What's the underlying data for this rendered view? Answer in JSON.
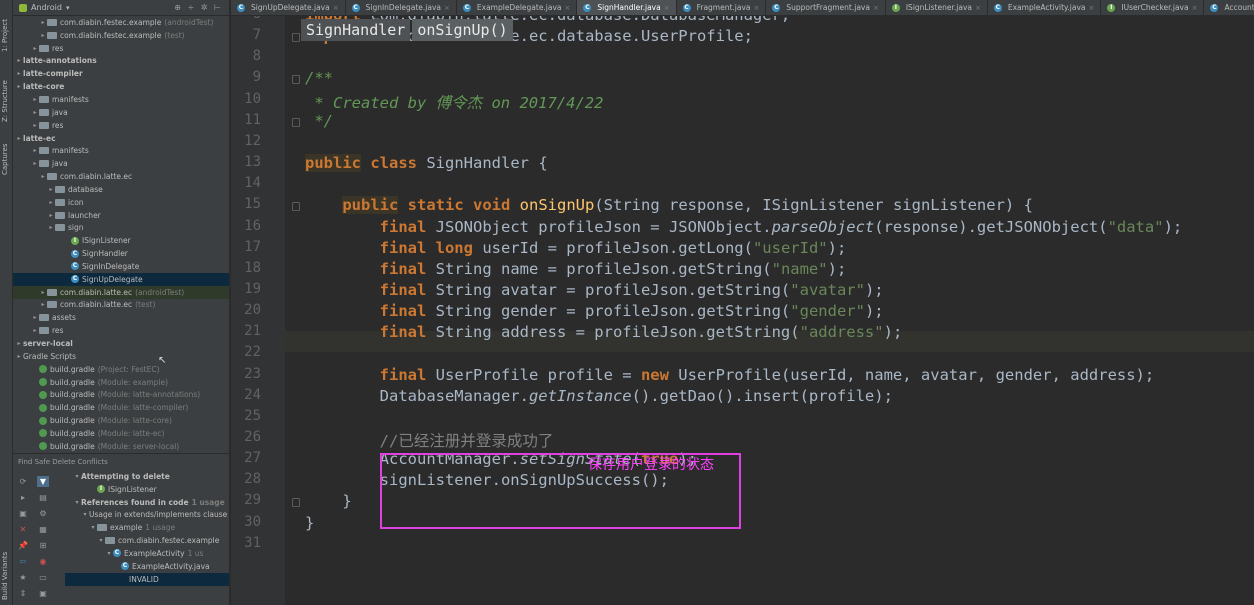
{
  "side_tabs": [
    "1: Project",
    "Z: Structure",
    "Captures",
    "Build Variants"
  ],
  "project_header": {
    "view": "Android",
    "tools": "⊕ ÷ ✲ ⊢"
  },
  "tree": [
    {
      "label": "com.diabin.festec.example",
      "note": "(androidTest)",
      "icon": "folder",
      "indent": 3
    },
    {
      "label": "com.diabin.festec.example",
      "note": "(test)",
      "icon": "folder",
      "indent": 3
    },
    {
      "label": "res",
      "note": "",
      "icon": "folder",
      "indent": 2
    },
    {
      "label": "latte-annotations",
      "note": "",
      "icon": "none",
      "indent": 0,
      "bold": true
    },
    {
      "label": "latte-compiler",
      "note": "",
      "icon": "none",
      "indent": 0,
      "bold": true
    },
    {
      "label": "latte-core",
      "note": "",
      "icon": "none",
      "indent": 0,
      "bold": true
    },
    {
      "label": "manifests",
      "note": "",
      "icon": "folder",
      "indent": 2
    },
    {
      "label": "java",
      "note": "",
      "icon": "folder",
      "indent": 2
    },
    {
      "label": "res",
      "note": "",
      "icon": "folder",
      "indent": 2
    },
    {
      "label": "latte-ec",
      "note": "",
      "icon": "none",
      "indent": 0,
      "bold": true
    },
    {
      "label": "manifests",
      "note": "",
      "icon": "folder",
      "indent": 2
    },
    {
      "label": "java",
      "note": "",
      "icon": "folder",
      "indent": 2
    },
    {
      "label": "com.diabin.latte.ec",
      "note": "",
      "icon": "folder",
      "indent": 3
    },
    {
      "label": "database",
      "note": "",
      "icon": "folder",
      "indent": 4
    },
    {
      "label": "icon",
      "note": "",
      "icon": "folder",
      "indent": 4
    },
    {
      "label": "launcher",
      "note": "",
      "icon": "folder",
      "indent": 4
    },
    {
      "label": "sign",
      "note": "",
      "icon": "folder",
      "indent": 4
    },
    {
      "label": "ISignListener",
      "note": "",
      "icon": "interface",
      "indent": 6
    },
    {
      "label": "SignHandler",
      "note": "",
      "icon": "class",
      "indent": 6
    },
    {
      "label": "SignInDelegate",
      "note": "",
      "icon": "class",
      "indent": 6
    },
    {
      "label": "SignUpDelegate",
      "note": "",
      "icon": "class",
      "indent": 6,
      "selected": true
    },
    {
      "label": "com.diabin.latte.ec",
      "note": "(androidTest)",
      "icon": "folder",
      "indent": 3,
      "green": true
    },
    {
      "label": "com.diabin.latte.ec",
      "note": "(test)",
      "icon": "folder",
      "indent": 3
    },
    {
      "label": "assets",
      "note": "",
      "icon": "folder",
      "indent": 2
    },
    {
      "label": "res",
      "note": "",
      "icon": "folder",
      "indent": 2
    },
    {
      "label": "server-local",
      "note": "",
      "icon": "none",
      "indent": 0,
      "bold": true
    },
    {
      "label": "Gradle Scripts",
      "note": "",
      "icon": "none",
      "indent": 0
    },
    {
      "label": "build.gradle",
      "note": "(Project: FestEC)",
      "icon": "gradle",
      "indent": 2
    },
    {
      "label": "build.gradle",
      "note": "(Module: example)",
      "icon": "gradle",
      "indent": 2
    },
    {
      "label": "build.gradle",
      "note": "(Module: latte-annotations)",
      "icon": "gradle",
      "indent": 2
    },
    {
      "label": "build.gradle",
      "note": "(Module: latte-compiler)",
      "icon": "gradle",
      "indent": 2
    },
    {
      "label": "build.gradle",
      "note": "(Module: latte-core)",
      "icon": "gradle",
      "indent": 2
    },
    {
      "label": "build.gradle",
      "note": "(Module: latte-ec)",
      "icon": "gradle",
      "indent": 2
    },
    {
      "label": "build.gradle",
      "note": "(Module: server-local)",
      "icon": "gradle",
      "indent": 2
    }
  ],
  "find_panel": {
    "title": "Find Safe Delete Conflicts",
    "rows": [
      {
        "label": "Attempting to delete",
        "indent": 1,
        "bold": true,
        "icon": "none",
        "note": ""
      },
      {
        "label": "ISignListener",
        "indent": 3,
        "icon": "interface",
        "note": ""
      },
      {
        "label": "References found in code",
        "indent": 1,
        "bold": true,
        "icon": "none",
        "note": "1 usage"
      },
      {
        "label": "Usage in extends/implements clause",
        "indent": 2,
        "icon": "none",
        "note": ""
      },
      {
        "label": "example",
        "indent": 3,
        "icon": "folder",
        "note": "1 usage"
      },
      {
        "label": "com.diabin.festec.example",
        "indent": 4,
        "icon": "folder",
        "note": ""
      },
      {
        "label": "ExampleActivity",
        "indent": 5,
        "icon": "class",
        "note": "1 us"
      },
      {
        "label": "ExampleActivity.java",
        "indent": 6,
        "icon": "class",
        "note": ""
      },
      {
        "label": "INVALID",
        "indent": 7,
        "icon": "none",
        "note": "",
        "selected": true
      }
    ]
  },
  "tabs": [
    {
      "label": "SignUpDelegate.java",
      "active": false
    },
    {
      "label": "SignInDelegate.java",
      "active": false
    },
    {
      "label": "ExampleDelegate.java",
      "active": false
    },
    {
      "label": "SignHandler.java",
      "active": true
    },
    {
      "label": "Fragment.java",
      "active": false
    },
    {
      "label": "SupportFragment.java",
      "active": false
    },
    {
      "label": "ISignListener.java",
      "active": false
    },
    {
      "label": "ExampleActivity.java",
      "active": false
    },
    {
      "label": "IUserChecker.java",
      "active": false
    },
    {
      "label": "AccountManager.java",
      "active": false
    }
  ],
  "breadcrumb": [
    "SignHandler",
    "onSignUp()"
  ],
  "code_lines": [
    {
      "n": "6",
      "html": "<span class=\"kw\">import</span> com.diabin.latte.ec.database.DatabaseManager;"
    },
    {
      "n": "7",
      "html": "<span class=\"kw\">import</span> com.diabin.latte.ec.database.UserProfile;"
    },
    {
      "n": "8",
      "html": ""
    },
    {
      "n": "9",
      "html": "<span class=\"cmt\">/**</span>"
    },
    {
      "n": "10",
      "html": "<span class=\"cmt\"> * Created by 傅令杰 on 2017/4/22</span>"
    },
    {
      "n": "11",
      "html": "<span class=\"cmt\"> */</span>"
    },
    {
      "n": "12",
      "html": ""
    },
    {
      "n": "13",
      "html": "<span class=\"kwh\">public</span> <span class=\"kw\">class</span> SignHandler {"
    },
    {
      "n": "14",
      "html": ""
    },
    {
      "n": "15",
      "html": "    <span class=\"kwh\">public</span> <span class=\"kw\">static void</span> <span class=\"fn\">onSignUp</span>(String response, ISignListener signListener) {"
    },
    {
      "n": "16",
      "html": "        <span class=\"kw\">final</span> JSONObject profileJson = JSONObject.<span class=\"it\">parseObject</span>(response).getJSONObject(<span class=\"str\">\"data\"</span>);"
    },
    {
      "n": "17",
      "html": "        <span class=\"kw\">final long</span> userId = profileJson.getLong(<span class=\"str\">\"userId\"</span>);"
    },
    {
      "n": "18",
      "html": "        <span class=\"kw\">final</span> String name = profileJson.getString(<span class=\"str\">\"name\"</span>);"
    },
    {
      "n": "19",
      "html": "        <span class=\"kw\">final</span> String avatar = profileJson.getString(<span class=\"str\">\"avatar\"</span>);"
    },
    {
      "n": "20",
      "html": "        <span class=\"kw\">final</span> String gender = profileJson.getString(<span class=\"str\">\"gender\"</span>);"
    },
    {
      "n": "21",
      "html": "        <span class=\"kw\">final</span> String address = profileJson.getString(<span class=\"str\">\"address\"</span>);"
    },
    {
      "n": "22",
      "html": ""
    },
    {
      "n": "23",
      "html": "        <span class=\"kw\">final</span> UserProfile profile = <span class=\"kw\">new</span> UserProfile(userId, name, avatar, gender, address);"
    },
    {
      "n": "24",
      "html": "        DatabaseManager.<span class=\"it\">getInstance</span>().getDao().insert(profile);"
    },
    {
      "n": "25",
      "html": ""
    },
    {
      "n": "26",
      "html": "        <span class=\"lc\">//已经注册并登录成功了</span>"
    },
    {
      "n": "27",
      "html": "        AccountManager.<span class=\"it\">setSignState</span>(<span class=\"kw\">true</span>);"
    },
    {
      "n": "28",
      "html": "        signListener.onSignUpSuccess();"
    },
    {
      "n": "29",
      "html": "    }"
    },
    {
      "n": "30",
      "html": "}"
    },
    {
      "n": "31",
      "html": ""
    }
  ],
  "annotation": "保存用户登录的状态",
  "colors": {
    "accent_box": "#e040e0",
    "annotation_text": "#ff40ff",
    "keyword": "#cc7832",
    "string": "#6a8759"
  }
}
